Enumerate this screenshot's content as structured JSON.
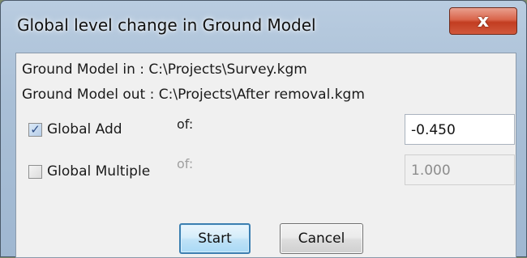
{
  "window": {
    "title": "Global level change in Ground Model",
    "close_glyph": "x"
  },
  "info": {
    "ground_model_in": "Ground Model in  : C:\\Projects\\Survey.kgm",
    "ground_model_out": "Ground Model out : C:\\Projects\\After removal.kgm"
  },
  "global_add": {
    "label": "Global Add",
    "checked": true,
    "of_label": "of:",
    "value": "-0.450"
  },
  "global_multiple": {
    "label": "Global Multiple",
    "checked": false,
    "of_label": "of:",
    "value": "1.000"
  },
  "buttons": {
    "start": "Start",
    "cancel": "Cancel"
  },
  "icons": {
    "close": "close-icon",
    "check": "check-icon"
  },
  "colors": {
    "titlebar": "#a9bfd6",
    "close_button": "#c23d21",
    "focus_border": "#3c7fb1"
  }
}
